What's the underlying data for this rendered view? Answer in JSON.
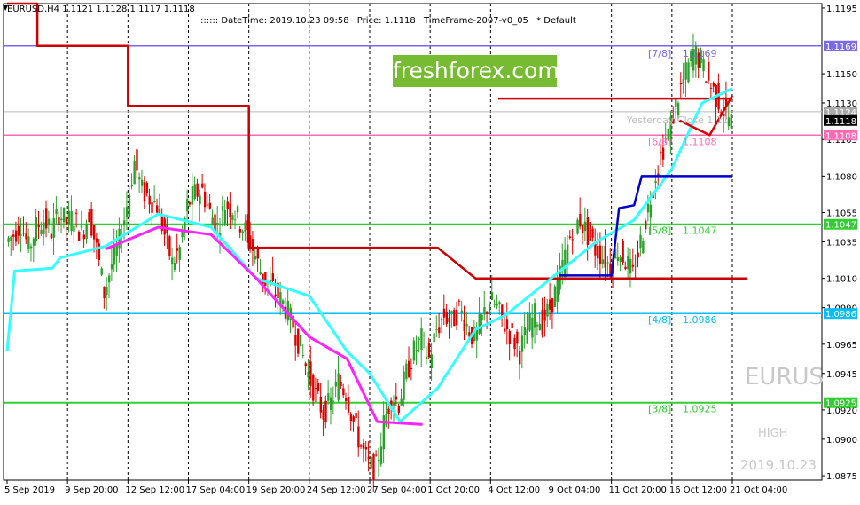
{
  "header": {
    "symbol_line": "EURUSD,H4  1.1121 1.1128 1.1117 1.1118",
    "datetime": ":::::: DateTime: 2019.10.23 09:58",
    "price": "Price: 1.1118",
    "timeframe": "TimeFrame-2007-v0_05",
    "default_label": "*  Default"
  },
  "watermark": "freshforex.com",
  "ghost_text": {
    "symbol": "EURUS",
    "high": "HIGH",
    "date": "2019.10.23",
    "yesterday_close": "Yesterday Close 1.11"
  },
  "colors": {
    "murrey_7_8": "#7b68ee",
    "murrey_6_8": "#ff69b4",
    "murrey_5_8": "#32cd32",
    "murrey_4_8": "#00bfff",
    "murrey_3_8": "#32cd32",
    "bull_candle": "#2ca02c",
    "bear_candle": "#dd0000",
    "trend_red": "#cc0000",
    "trend_cyan": "#33ffff",
    "trend_magenta": "#ff22ff",
    "trend_blue": "#0000cc",
    "watermark_bg": "#77bb33"
  },
  "chart_data": {
    "type": "line",
    "title": "EURUSD,H4",
    "ylim": [
      1.0872,
      1.1198
    ],
    "y_ticks": [
      "1.1195",
      "1.1150",
      "1.1130",
      "1.1105",
      "1.1080",
      "1.1055",
      "1.1035",
      "1.1010",
      "1.0990",
      "1.0965",
      "1.0945",
      "1.0920",
      "1.0900",
      "1.0875"
    ],
    "x_ticks": [
      "5 Sep 2019",
      "9 Sep 20:00",
      "12 Sep 12:00",
      "17 Sep 04:00",
      "19 Sep 20:00",
      "24 Sep 12:00",
      "27 Sep 04:00",
      "1 Oct 20:00",
      "4 Oct 12:00",
      "9 Oct 04:00",
      "11 Oct 20:00",
      "16 Oct 12:00",
      "21 Oct 04:00"
    ],
    "murrey_levels": [
      {
        "label": "[7/8]",
        "value": 1.1169,
        "text": "1.1169"
      },
      {
        "label": "[6/8]",
        "value": 1.1108,
        "text": "1.1108"
      },
      {
        "label": "[5/8]",
        "value": 1.1047,
        "text": "1.1047"
      },
      {
        "label": "[4/8]",
        "value": 1.0986,
        "text": "1.0986"
      },
      {
        "label": "[3/8]",
        "value": 1.0925,
        "text": "1.0925"
      }
    ],
    "price_tags": [
      {
        "text": "1.1169",
        "value": 1.1169
      },
      {
        "text": "1.1124",
        "value": 1.1124
      },
      {
        "text": "1.1118",
        "value": 1.1118
      },
      {
        "text": "1.1108",
        "value": 1.1108
      },
      {
        "text": "1.1047",
        "value": 1.1047
      },
      {
        "text": "1.0986",
        "value": 1.0986
      },
      {
        "text": "1.0925",
        "value": 1.0925
      }
    ],
    "current_price": 1.1118,
    "yesterday_close": 1.1124,
    "close_series": [
      1.1035,
      1.104,
      1.1048,
      1.103,
      1.1045,
      1.105,
      1.1042,
      1.1055,
      1.1048,
      1.1052,
      1.104,
      1.1055,
      1.103,
      1.1,
      1.102,
      1.1035,
      1.106,
      1.109,
      1.107,
      1.1065,
      1.106,
      1.104,
      1.102,
      1.103,
      1.106,
      1.1068,
      1.107,
      1.1055,
      1.1045,
      1.106,
      1.1058,
      1.1048,
      1.104,
      1.1025,
      1.101,
      1.1005,
      1.0998,
      1.099,
      1.0978,
      1.0962,
      1.0945,
      1.093,
      1.0918,
      1.0925,
      1.094,
      1.0932,
      1.0912,
      1.0895,
      1.0882,
      1.088,
      1.091,
      1.093,
      1.0925,
      1.0945,
      1.096,
      1.0968,
      1.0955,
      1.0975,
      1.0985,
      1.098,
      1.099,
      1.0978,
      1.0968,
      1.0982,
      1.0995,
      1.099,
      1.0978,
      1.097,
      1.096,
      1.0975,
      1.0985,
      1.098,
      1.099,
      1.1005,
      1.1025,
      1.1045,
      1.105,
      1.104,
      1.103,
      1.1025,
      1.1018,
      1.103,
      1.1022,
      1.1012,
      1.1035,
      1.1058,
      1.1082,
      1.11,
      1.1115,
      1.1135,
      1.115,
      1.1165,
      1.1158,
      1.1145,
      1.1135,
      1.1125,
      1.1118
    ],
    "candle_segments": [
      {
        "from": 0,
        "to": 28,
        "bull_ratio": 0.5
      },
      {
        "from": 28,
        "to": 50,
        "bull_ratio": 0.35
      },
      {
        "from": 50,
        "to": 97,
        "bull_ratio": 0.62
      }
    ],
    "trend_red": [
      [
        0,
        1.1198
      ],
      [
        4,
        1.1198
      ],
      [
        4,
        1.1169
      ],
      [
        16,
        1.1169
      ],
      [
        16,
        1.1128
      ],
      [
        32,
        1.1128
      ],
      [
        32,
        1.1031
      ],
      [
        57,
        1.1031
      ],
      [
        62,
        1.101
      ],
      [
        98,
        1.101
      ]
    ],
    "trend_red_right": [
      [
        65,
        1.1133
      ],
      [
        96,
        1.1133
      ]
    ],
    "trend_cyan": [
      [
        0,
        1.096
      ],
      [
        1,
        1.1015
      ],
      [
        6,
        1.1017
      ],
      [
        7,
        1.1024
      ],
      [
        13,
        1.1032
      ],
      [
        20,
        1.1054
      ],
      [
        27,
        1.1045
      ],
      [
        33,
        1.101
      ],
      [
        40,
        1.0998
      ],
      [
        45,
        1.096
      ],
      [
        48,
        1.0945
      ],
      [
        52,
        1.0912
      ],
      [
        57,
        1.0935
      ],
      [
        62,
        1.0975
      ],
      [
        66,
        1.0985
      ],
      [
        72,
        1.101
      ],
      [
        78,
        1.1035
      ],
      [
        83,
        1.105
      ],
      [
        88,
        1.1085
      ],
      [
        92,
        1.113
      ],
      [
        96,
        1.114
      ]
    ],
    "trend_magenta": [
      [
        13,
        1.103
      ],
      [
        20,
        1.1045
      ],
      [
        27,
        1.104
      ],
      [
        33,
        1.101
      ],
      [
        40,
        1.097
      ],
      [
        45,
        1.0955
      ],
      [
        49,
        1.0912
      ],
      [
        55,
        1.091
      ]
    ],
    "trend_blue": [
      [
        73,
        1.1012
      ],
      [
        80,
        1.1012
      ],
      [
        81,
        1.1058
      ],
      [
        83,
        1.106
      ],
      [
        84,
        1.108
      ],
      [
        96,
        1.108
      ]
    ],
    "forecast_path": [
      [
        89,
        1.1118
      ],
      [
        93,
        1.1108
      ],
      [
        96,
        1.1135
      ]
    ]
  }
}
